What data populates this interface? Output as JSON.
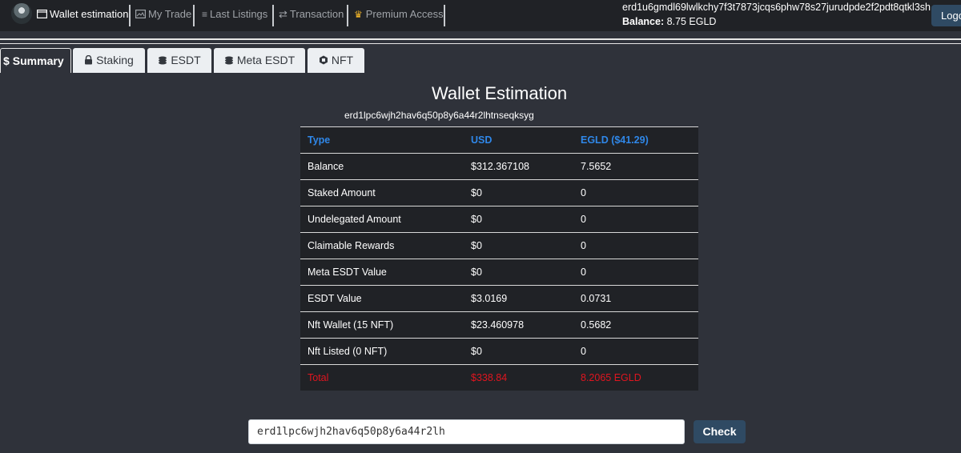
{
  "nav": {
    "items": [
      {
        "label": "Wallet estimation"
      },
      {
        "label": "My Trade"
      },
      {
        "label": "Last Listings"
      },
      {
        "label": "Transaction"
      },
      {
        "label": "Premium Access"
      }
    ],
    "account_address": "erd1u6gmdl69lwlkchy7f3t7873jcqs6phw78s27jurudpde2f2pdt8qtkl3sh",
    "balance_label": "Balance:",
    "balance_value": "8.75 EGLD",
    "logout_label": "Logout"
  },
  "tabs": [
    {
      "label": "Summary"
    },
    {
      "label": "Staking"
    },
    {
      "label": "ESDT"
    },
    {
      "label": "Meta ESDT"
    },
    {
      "label": "NFT"
    }
  ],
  "main": {
    "title": "Wallet Estimation",
    "address": "erd1lpc6wjh2hav6q50p8y6a44r2lhtnseqksyg"
  },
  "table": {
    "headers": [
      "Type",
      "USD",
      "EGLD ($41.29)"
    ],
    "rows": [
      [
        "Balance",
        "$312.367108",
        "7.5652"
      ],
      [
        "Staked Amount",
        "$0",
        "0"
      ],
      [
        "Undelegated Amount",
        "$0",
        "0"
      ],
      [
        "Claimable Rewards",
        "$0",
        "0"
      ],
      [
        "Meta ESDT Value",
        "$0",
        "0"
      ],
      [
        "ESDT Value",
        "$3.0169",
        "0.0731"
      ],
      [
        "Nft Wallet (15 NFT)",
        "$23.460978",
        "0.5682"
      ],
      [
        "Nft Listed (0 NFT)",
        "$0",
        "0"
      ]
    ],
    "total": [
      "Total",
      "$338.84",
      "8.2065 EGLD"
    ]
  },
  "search": {
    "value": "erd1lpc6wjh2hav6q50p8y6a44r2lh",
    "button_label": "Check"
  },
  "colors": {
    "accent_blue": "#2f87e8",
    "total_red": "#e0151f",
    "button": "#2f4a63"
  }
}
